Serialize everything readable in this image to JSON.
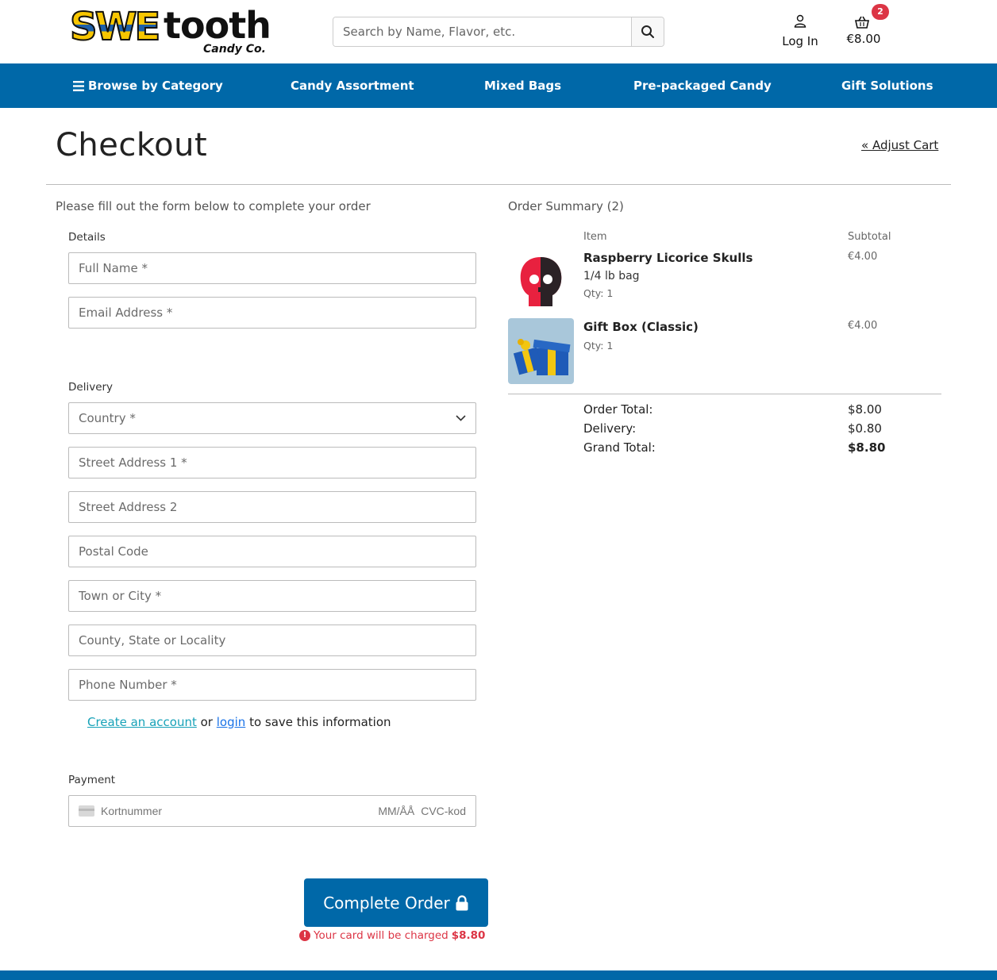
{
  "brand": {
    "logo_main": "SWE",
    "logo_rest": "tooth",
    "logo_sub": "Candy Co."
  },
  "search": {
    "placeholder": "Search by Name, Flavor, etc."
  },
  "account": {
    "login_label": "Log In"
  },
  "cart": {
    "count": "2",
    "total": "€8.00"
  },
  "nav": {
    "items": [
      "Browse by Category",
      "Candy Assortment",
      "Mixed Bags",
      "Pre-packaged Candy",
      "Gift Solutions"
    ]
  },
  "page": {
    "title": "Checkout",
    "adjust_cart": "« Adjust Cart",
    "intro": "Please fill out the form below to complete your order"
  },
  "form": {
    "details_legend": "Details",
    "full_name_placeholder": "Full Name *",
    "email_placeholder": "Email Address *",
    "delivery_legend": "Delivery",
    "country_placeholder": "Country *",
    "street1_placeholder": "Street Address 1 *",
    "street2_placeholder": "Street Address 2",
    "postal_placeholder": "Postal Code",
    "town_placeholder": "Town or City *",
    "county_placeholder": "County, State or Locality",
    "phone_placeholder": "Phone Number *",
    "create_account": "Create an account",
    "or": "or",
    "login": "login",
    "save_info": "to save this information",
    "payment_legend": "Payment",
    "card_number_placeholder": "Kortnummer",
    "card_expiry_placeholder": "MM/ÅÅ",
    "card_cvc_placeholder": "CVC-kod"
  },
  "submit": {
    "label": "Complete Order",
    "charge_text": "Your card will be charged",
    "charge_amount": "$8.80"
  },
  "summary": {
    "title": "Order Summary (2)",
    "col_item": "Item",
    "col_subtotal": "Subtotal",
    "items": [
      {
        "name": "Raspberry Licorice Skulls",
        "size": "1/4 lb bag",
        "qty": "Qty: 1",
        "subtotal": "€4.00"
      },
      {
        "name": "Gift Box (Classic)",
        "qty": "Qty: 1",
        "subtotal": "€4.00"
      }
    ],
    "order_total_label": "Order Total:",
    "order_total": "$8.00",
    "delivery_label": "Delivery:",
    "delivery": "$0.80",
    "grand_total_label": "Grand Total:",
    "grand_total": "$8.80"
  },
  "colors": {
    "primary": "#0068a8",
    "danger": "#dc3545",
    "link": "#17a2b8"
  }
}
